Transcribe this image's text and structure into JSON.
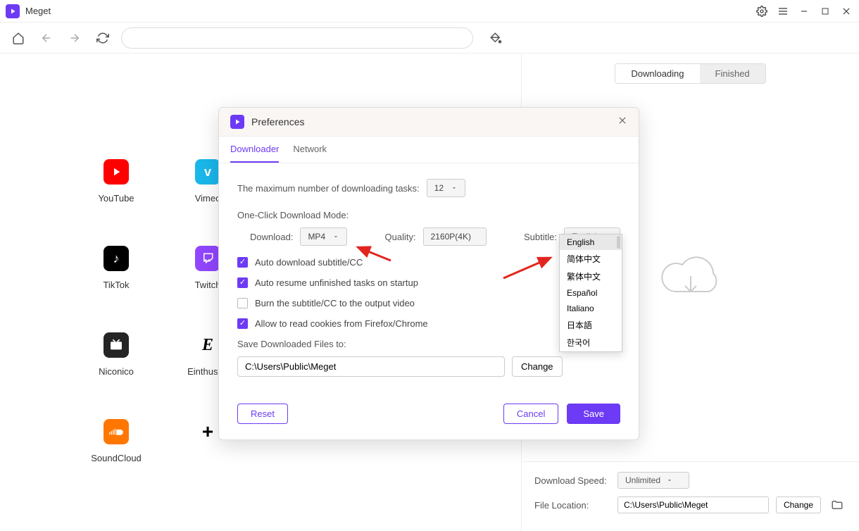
{
  "app": {
    "title": "Meget"
  },
  "sites": {
    "youtube": "YouTube",
    "vimeo": "Vimeo",
    "tiktok": "TikTok",
    "twitch": "Twitch",
    "niconico": "Niconico",
    "einthusan": "Einthusan",
    "soundcloud": "SoundCloud"
  },
  "right": {
    "tab_downloading": "Downloading",
    "tab_finished": "Finished",
    "download_speed_label": "Download Speed:",
    "download_speed_value": "Unlimited",
    "file_location_label": "File Location:",
    "file_location_value": "C:\\Users\\Public\\Meget",
    "change": "Change"
  },
  "dialog": {
    "title": "Preferences",
    "tab_downloader": "Downloader",
    "tab_network": "Network",
    "max_tasks_label": "The maximum number of downloading tasks:",
    "max_tasks_value": "12",
    "one_click_label": "One-Click Download Mode:",
    "download_label": "Download:",
    "download_value": "MP4",
    "quality_label": "Quality:",
    "quality_value": "2160P(4K)",
    "subtitle_label": "Subtitle:",
    "subtitle_value": "English",
    "chk_auto_sub": "Auto download subtitle/CC",
    "chk_auto_resume": "Auto resume unfinished tasks on startup",
    "chk_burn": "Burn the subtitle/CC to the output video",
    "chk_cookies": "Allow to read cookies from Firefox/Chrome",
    "save_to_label": "Save Downloaded Files to:",
    "save_to_value": "C:\\Users\\Public\\Meget",
    "change": "Change",
    "reset": "Reset",
    "cancel": "Cancel",
    "save": "Save"
  },
  "subtitles": [
    "English",
    "简体中文",
    "繁体中文",
    "Español",
    "Italiano",
    "日本語",
    "한국어"
  ]
}
